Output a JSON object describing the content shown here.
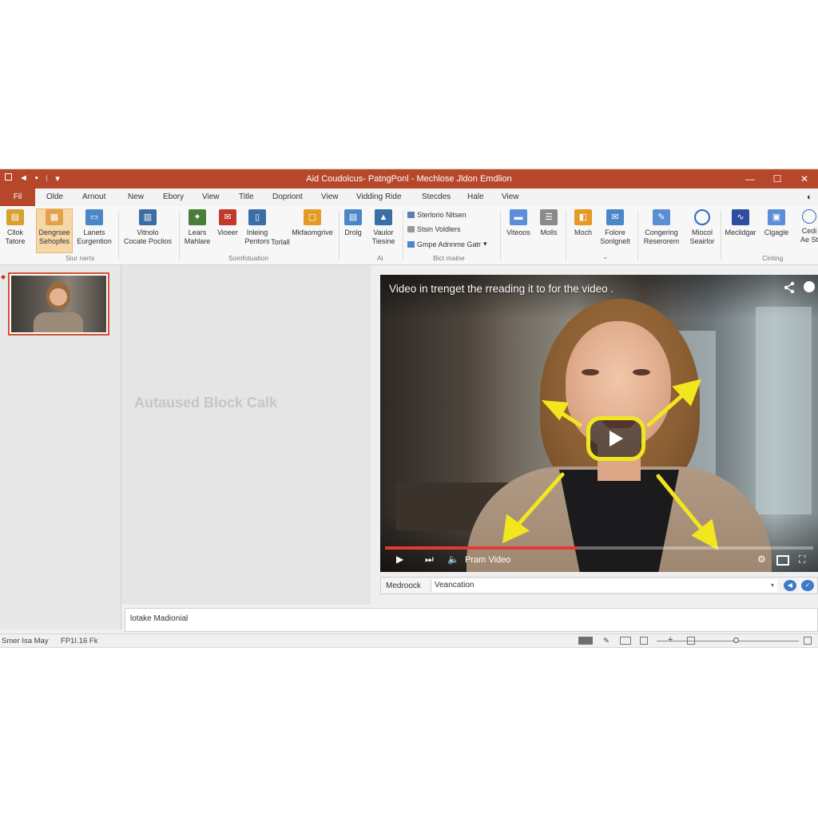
{
  "window": {
    "title": "Aid Coudolcus- PatngPonl - Mechlose Jldon Emdlion",
    "quick_access": [
      "◄",
      "▪",
      "⁝",
      "▾"
    ],
    "controls": {
      "minimize": "—",
      "maximize": "☐",
      "close": "✕"
    }
  },
  "tabs": [
    {
      "label": "Fil",
      "active": true
    },
    {
      "label": "Olde"
    },
    {
      "label": "Arnout"
    },
    {
      "label": "New"
    },
    {
      "label": "Ebory"
    },
    {
      "label": "View"
    },
    {
      "label": "Title"
    },
    {
      "label": "Dopriont"
    },
    {
      "label": "View"
    },
    {
      "label": "Vidding Ride"
    },
    {
      "label": "Stecdes"
    },
    {
      "label": "Hale"
    },
    {
      "label": "View"
    }
  ],
  "ribbon": {
    "buttons": [
      {
        "line1": "Cllok",
        "line2": "Tatore",
        "icon": "clipboard-icon",
        "color": "#d8a02c"
      },
      {
        "line1": "Dengrsee",
        "line2": "Sehopfes",
        "icon": "slide-layout-icon",
        "color": "#e3a14b",
        "active": true
      },
      {
        "line1": "Lanets",
        "line2": "Eurgention",
        "icon": "screen-icon",
        "color": "#4a86c8"
      },
      {
        "line1": "Vitnolo",
        "line2": "Cocate Poclios",
        "icon": "chart-icon",
        "color": "#3a6ea5"
      },
      {
        "line1": "Lears",
        "line2": "Mahlare",
        "icon": "figure-icon",
        "color": "#4a7d3a"
      },
      {
        "line1": "Vioeer",
        "line2": "",
        "icon": "mailbox-icon",
        "color": "#c0392b"
      },
      {
        "line1": "Inleing",
        "line2": "Pentors",
        "icon": "document-icon",
        "color": "#3a6ea5"
      },
      {
        "line1": "Torlall",
        "line2": "",
        "icon": "",
        "color": ""
      },
      {
        "line1": "Mkfaomgrive",
        "line2": "",
        "icon": "note-icon",
        "color": "#e59a24"
      },
      {
        "line1": "Drolg",
        "line2": "",
        "icon": "gallery-icon",
        "color": "#4a86c8"
      },
      {
        "line1": "Vaulor",
        "line2": "Tiesine",
        "icon": "photo-icon",
        "color": "#3a6ea5"
      },
      {
        "line1": "Viteoos",
        "line2": "",
        "icon": "video-strip-icon",
        "color": "#5b8ed6"
      },
      {
        "line1": "Molls",
        "line2": "",
        "icon": "lines-icon",
        "color": "#8a8a8a"
      },
      {
        "line1": "Moch",
        "line2": "",
        "icon": "bookmark-icon",
        "color": "#e59a24"
      },
      {
        "line1": "Folore",
        "line2": "Sonlgnelt",
        "icon": "mail-icon",
        "color": "#4a86c8"
      },
      {
        "line1": "Congering",
        "line2": "Reserorem",
        "icon": "edit-icon",
        "color": "#5b8ed6"
      },
      {
        "line1": "Miocol",
        "line2": "Seairlor",
        "icon": "circle-icon",
        "color": "#2e6bbf"
      },
      {
        "line1": "Meclidgar",
        "line2": "",
        "icon": "waveform-icon",
        "color": "#2e4fa0"
      },
      {
        "line1": "Clgagle",
        "line2": "",
        "icon": "image-frame-icon",
        "color": "#5b8ed6"
      },
      {
        "line1": "Cedi",
        "line2": "Ae St",
        "icon": "clock-icon",
        "color": "#2e6bbf"
      }
    ],
    "small_items": [
      "Sterlorio Nitsen",
      "Stsin Voldlers",
      "Gmpe Adnnme Gatr"
    ],
    "group_labels": [
      "Siur nerts",
      "Somfotuation",
      "Ai",
      "Bict malne",
      "Cinting"
    ]
  },
  "canvas": {
    "watermark": "Autaused Block Calk"
  },
  "video": {
    "title": "Video in trenget the rreading it to for the video .",
    "progress_percent": 45,
    "controls": {
      "play": "▶",
      "next": "⏭",
      "volume": "🔈",
      "label": "Pram Video"
    }
  },
  "media_bar": {
    "label": "Medroock",
    "value": "Veancation"
  },
  "notes": {
    "text": "lotake Madionial"
  },
  "status": {
    "left1": "Smer Isa May",
    "left2": "FP1I.16 Fk"
  }
}
